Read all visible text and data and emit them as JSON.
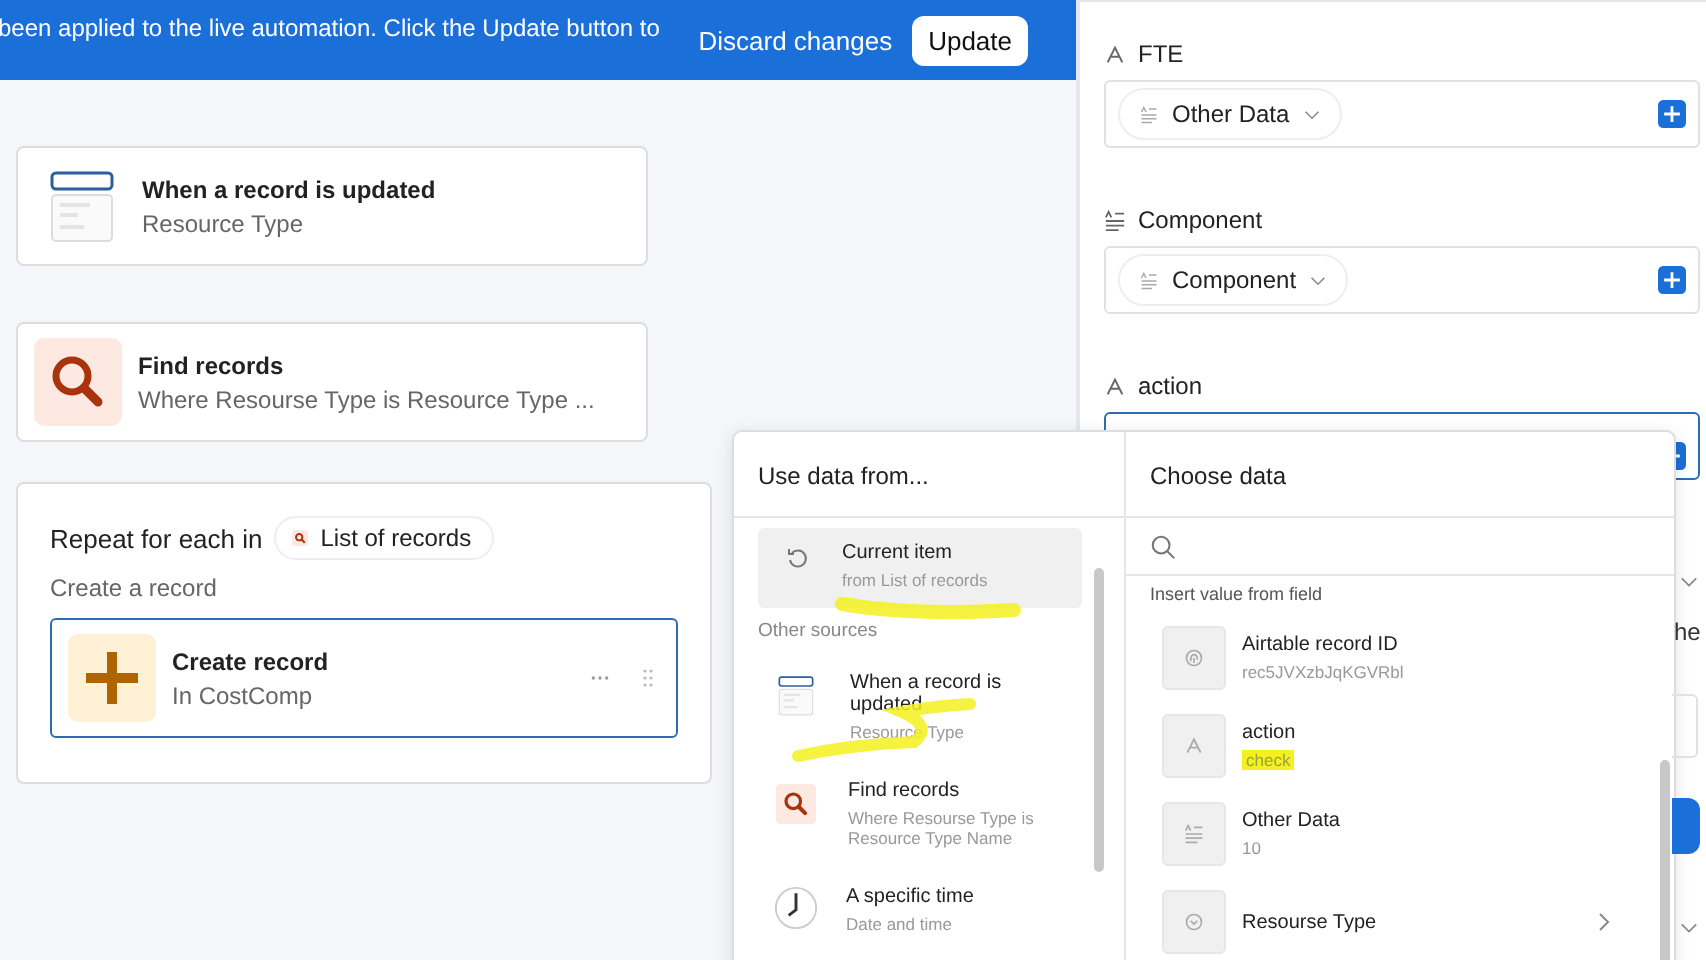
{
  "banner": {
    "message": "been applied to the live automation. Click the Update button to",
    "discard": "Discard changes",
    "update": "Update"
  },
  "steps": [
    {
      "kind": "trigger",
      "title": "When a record is updated",
      "subtitle": "Resource Type"
    },
    {
      "kind": "find",
      "title": "Find records",
      "subtitle": "Where Resourse Type is Resource Type ..."
    }
  ],
  "repeat": {
    "label": "Repeat for each in",
    "source": "List of records",
    "caption": "Create a record",
    "action": {
      "title": "Create record",
      "subtitle": "In CostComp",
      "selected": true
    }
  },
  "fields": [
    {
      "label": "FTE",
      "kind": "text",
      "focused": false,
      "token": {
        "label": "Other Data",
        "kind": "longtext"
      }
    },
    {
      "label": "Component",
      "kind": "longtext",
      "focused": false,
      "token": {
        "label": "Component",
        "kind": "longtext"
      }
    },
    {
      "label": "action",
      "kind": "text",
      "focused": true
    }
  ],
  "behind": {
    "text": "he"
  },
  "picker": {
    "sources_title": "Use data from...",
    "current": {
      "title": "Current item",
      "subtitle": "from List of records",
      "selected": true
    },
    "other_title": "Other sources",
    "sources": [
      {
        "kind": "trigger",
        "title": "When a record is updated",
        "subtitle": "Resource Type"
      },
      {
        "kind": "find",
        "title": "Find records",
        "subtitle": "Where Resourse Type is Resource Type Name"
      },
      {
        "kind": "time",
        "title": "A specific time",
        "subtitle": "Date and time"
      }
    ],
    "data_title": "Choose data",
    "section": "Insert value from field",
    "items": [
      {
        "kind": "id",
        "name": "Airtable record ID",
        "value": "rec5JVXzbJqKGVRbl"
      },
      {
        "kind": "text",
        "name": "action",
        "value": "check"
      },
      {
        "kind": "longtext",
        "name": "Other Data",
        "value": "10"
      },
      {
        "kind": "select",
        "name": "Resourse Type",
        "expandable": true
      }
    ]
  }
}
